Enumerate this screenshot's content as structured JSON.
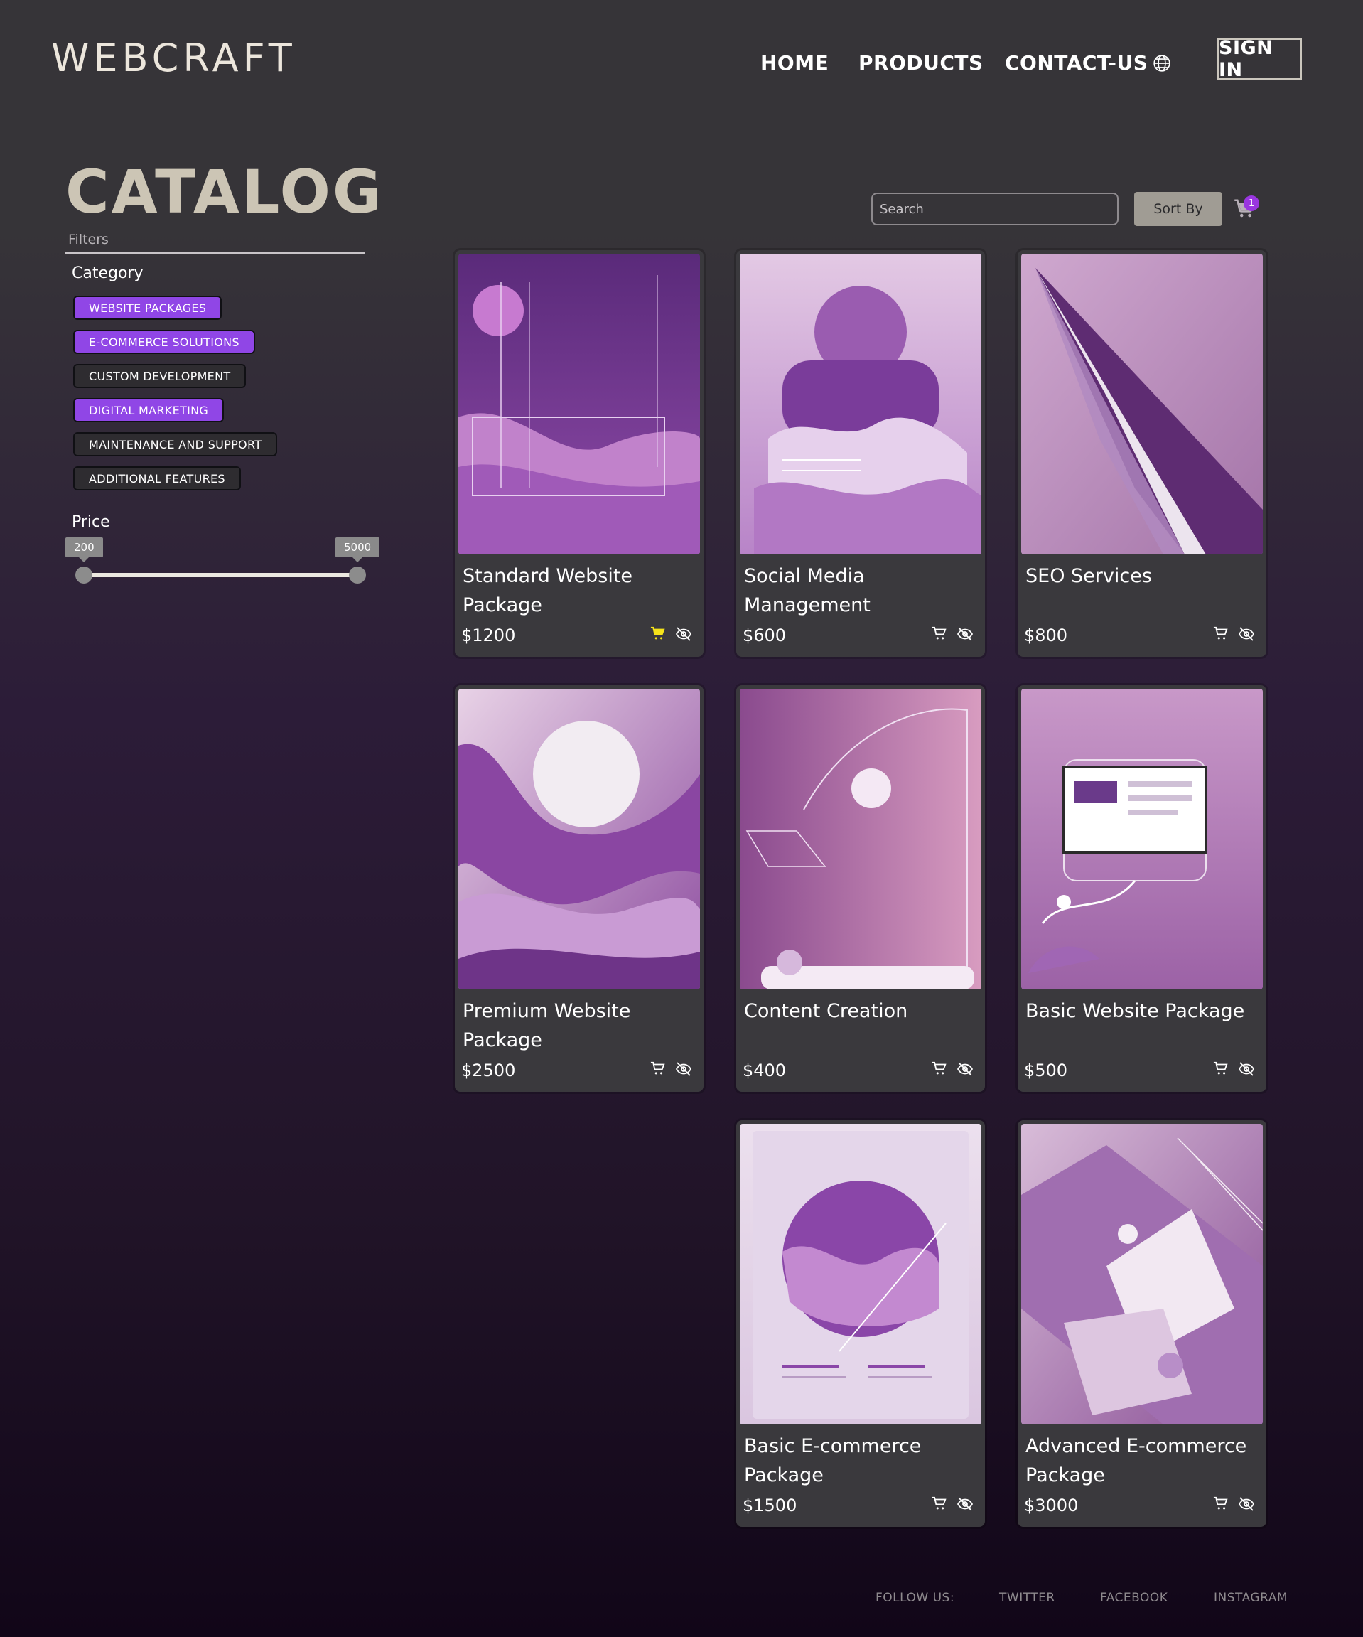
{
  "header": {
    "logo": "WEBCRAFT",
    "nav": {
      "home": "HOME",
      "products": "PRODUCTS",
      "contact": "CONTACT-US"
    },
    "globe_icon": "globe-icon",
    "sign_in": "SIGN IN"
  },
  "catalog": {
    "title": "CATALOG",
    "filters_label": "Filters",
    "category_label": "Category",
    "categories": [
      {
        "label": "WEBSITE PACKAGES",
        "active": true
      },
      {
        "label": "E-COMMERCE SOLUTIONS",
        "active": true
      },
      {
        "label": "CUSTOM DEVELOPMENT",
        "active": false
      },
      {
        "label": "DIGITAL MARKETING",
        "active": true
      },
      {
        "label": "MAINTENANCE AND SUPPORT",
        "active": false
      },
      {
        "label": "ADDITIONAL FEATURES",
        "active": false
      }
    ],
    "price_label": "Price",
    "price_min": "200",
    "price_max": "5000"
  },
  "toolbar": {
    "search_placeholder": "Search",
    "sort_label": "Sort By",
    "cart_icon": "cart-icon",
    "cart_count": "1"
  },
  "products": [
    {
      "title": "Standard Website Package",
      "price": "$1200",
      "in_cart": true
    },
    {
      "title": "Social Media Management",
      "price": "$600",
      "in_cart": false
    },
    {
      "title": "SEO Services",
      "price": "$800",
      "in_cart": false
    },
    {
      "title": "Premium Website Package",
      "price": "$2500",
      "in_cart": false
    },
    {
      "title": "Content Creation",
      "price": "$400",
      "in_cart": false
    },
    {
      "title": "Basic Website Package",
      "price": "$500",
      "in_cart": false
    },
    {
      "title": "Basic E-commerce Package",
      "price": "$1500",
      "in_cart": false
    },
    {
      "title": "Advanced E-commerce Package",
      "price": "$3000",
      "in_cart": false
    }
  ],
  "product_icons": {
    "cart": "cart-icon",
    "hide": "eye-slash-icon"
  },
  "colors": {
    "accent": "#9046e6",
    "cart_active": "#f5e31a",
    "badge": "#9a36e0",
    "sort_button": "#a09c94",
    "heading": "#ccc5b5"
  },
  "footer": {
    "follow": "FOLLOW US:",
    "twitter": "TWITTER",
    "facebook": "FACEBOOK",
    "instagram": "INSTAGRAM"
  }
}
